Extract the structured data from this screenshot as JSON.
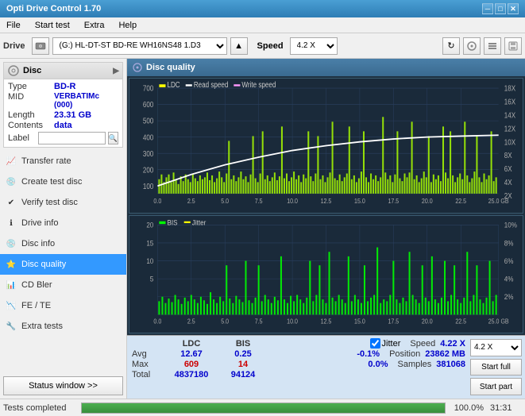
{
  "titlebar": {
    "title": "Opti Drive Control 1.70",
    "minimize": "─",
    "maximize": "□",
    "close": "✕"
  },
  "menubar": {
    "items": [
      "File",
      "Start test",
      "Extra",
      "Help"
    ]
  },
  "drivebar": {
    "label": "Drive",
    "drive_value": "(G:)  HL-DT-ST BD-RE  WH16NS48 1.D3",
    "speed_label": "Speed",
    "speed_value": "4.2 X"
  },
  "disc_panel": {
    "title": "Disc",
    "rows": [
      {
        "key": "Type",
        "val": "BD-R"
      },
      {
        "key": "MID",
        "val": "VERBATIMc (000)"
      },
      {
        "key": "Length",
        "val": "23.31 GB"
      },
      {
        "key": "Contents",
        "val": "data"
      }
    ],
    "label_placeholder": ""
  },
  "nav": {
    "items": [
      {
        "id": "transfer-rate",
        "label": "Transfer rate",
        "icon": "📈"
      },
      {
        "id": "create-test-disc",
        "label": "Create test disc",
        "icon": "💿"
      },
      {
        "id": "verify-test-disc",
        "label": "Verify test disc",
        "icon": "✔"
      },
      {
        "id": "drive-info",
        "label": "Drive info",
        "icon": "ℹ"
      },
      {
        "id": "disc-info",
        "label": "Disc info",
        "icon": "💿"
      },
      {
        "id": "disc-quality",
        "label": "Disc quality",
        "icon": "⭐",
        "active": true
      },
      {
        "id": "cd-bler",
        "label": "CD Bler",
        "icon": "📊"
      },
      {
        "id": "fe-te",
        "label": "FE / TE",
        "icon": "📉"
      },
      {
        "id": "extra-tests",
        "label": "Extra tests",
        "icon": "🔧"
      }
    ],
    "status_btn": "Status window >>"
  },
  "content": {
    "title": "Disc quality",
    "chart1": {
      "legend": [
        {
          "label": "LDC",
          "color": "#ffff00"
        },
        {
          "label": "Read speed",
          "color": "#ffffff"
        },
        {
          "label": "Write speed",
          "color": "#ff66ff"
        }
      ],
      "y_left_max": 700,
      "y_right_labels": [
        "18X",
        "16X",
        "14X",
        "12X",
        "10X",
        "8X",
        "6X",
        "4X",
        "2X"
      ],
      "x_labels": [
        "0.0",
        "2.5",
        "5.0",
        "7.5",
        "10.0",
        "12.5",
        "15.0",
        "17.5",
        "20.0",
        "22.5",
        "25.0 GB"
      ]
    },
    "chart2": {
      "legend": [
        {
          "label": "BIS",
          "color": "#00ff00"
        },
        {
          "label": "Jitter",
          "color": "#ffff00"
        }
      ],
      "y_left_max": 20,
      "y_right_labels": [
        "10%",
        "8%",
        "6%",
        "4%",
        "2%"
      ],
      "x_labels": [
        "0.0",
        "2.5",
        "5.0",
        "7.5",
        "10.0",
        "12.5",
        "15.0",
        "17.5",
        "20.0",
        "22.5",
        "25.0 GB"
      ]
    }
  },
  "stats": {
    "headers": [
      "",
      "LDC",
      "BIS",
      "",
      "Jitter",
      "Speed",
      ""
    ],
    "avg_label": "Avg",
    "avg_ldc": "12.67",
    "avg_bis": "0.25",
    "avg_jitter": "-0.1%",
    "max_label": "Max",
    "max_ldc": "609",
    "max_bis": "14",
    "max_jitter": "0.0%",
    "total_label": "Total",
    "total_ldc": "4837180",
    "total_bis": "94124",
    "speed_label": "Speed",
    "speed_val": "4.22 X",
    "position_label": "Position",
    "position_val": "23862 MB",
    "samples_label": "Samples",
    "samples_val": "381068",
    "jitter_checked": true,
    "jitter_label": "Jitter",
    "speed_dropdown": "4.2 X",
    "btn_start_full": "Start full",
    "btn_start_part": "Start part"
  },
  "statusbar": {
    "text": "Tests completed",
    "progress": 100,
    "progress_text": "100.0%",
    "time": "31:31"
  }
}
